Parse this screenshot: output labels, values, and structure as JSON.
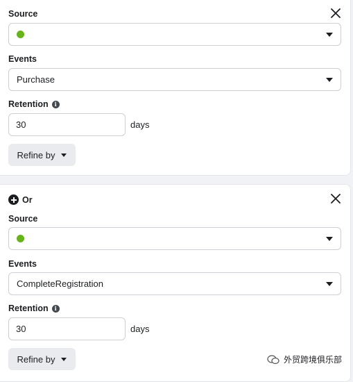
{
  "colors": {
    "source_dot": "#66b31a"
  },
  "icons": {
    "close": "close-icon",
    "info": "info-icon",
    "plus": "plus-circle-icon",
    "caret": "caret-down-icon",
    "watermark": "wechat-icon"
  },
  "blocks": [
    {
      "source_label": "Source",
      "source_value": "",
      "events_label": "Events",
      "events_value": "Purchase",
      "retention_label": "Retention",
      "retention_value": "30",
      "retention_unit": "days",
      "refine_label": "Refine by"
    },
    {
      "connector_label": "Or",
      "source_label": "Source",
      "source_value": "",
      "events_label": "Events",
      "events_value": "CompleteRegistration",
      "retention_label": "Retention",
      "retention_value": "30",
      "retention_unit": "days",
      "refine_label": "Refine by"
    }
  ],
  "watermark_text": "外贸跨境俱乐部"
}
